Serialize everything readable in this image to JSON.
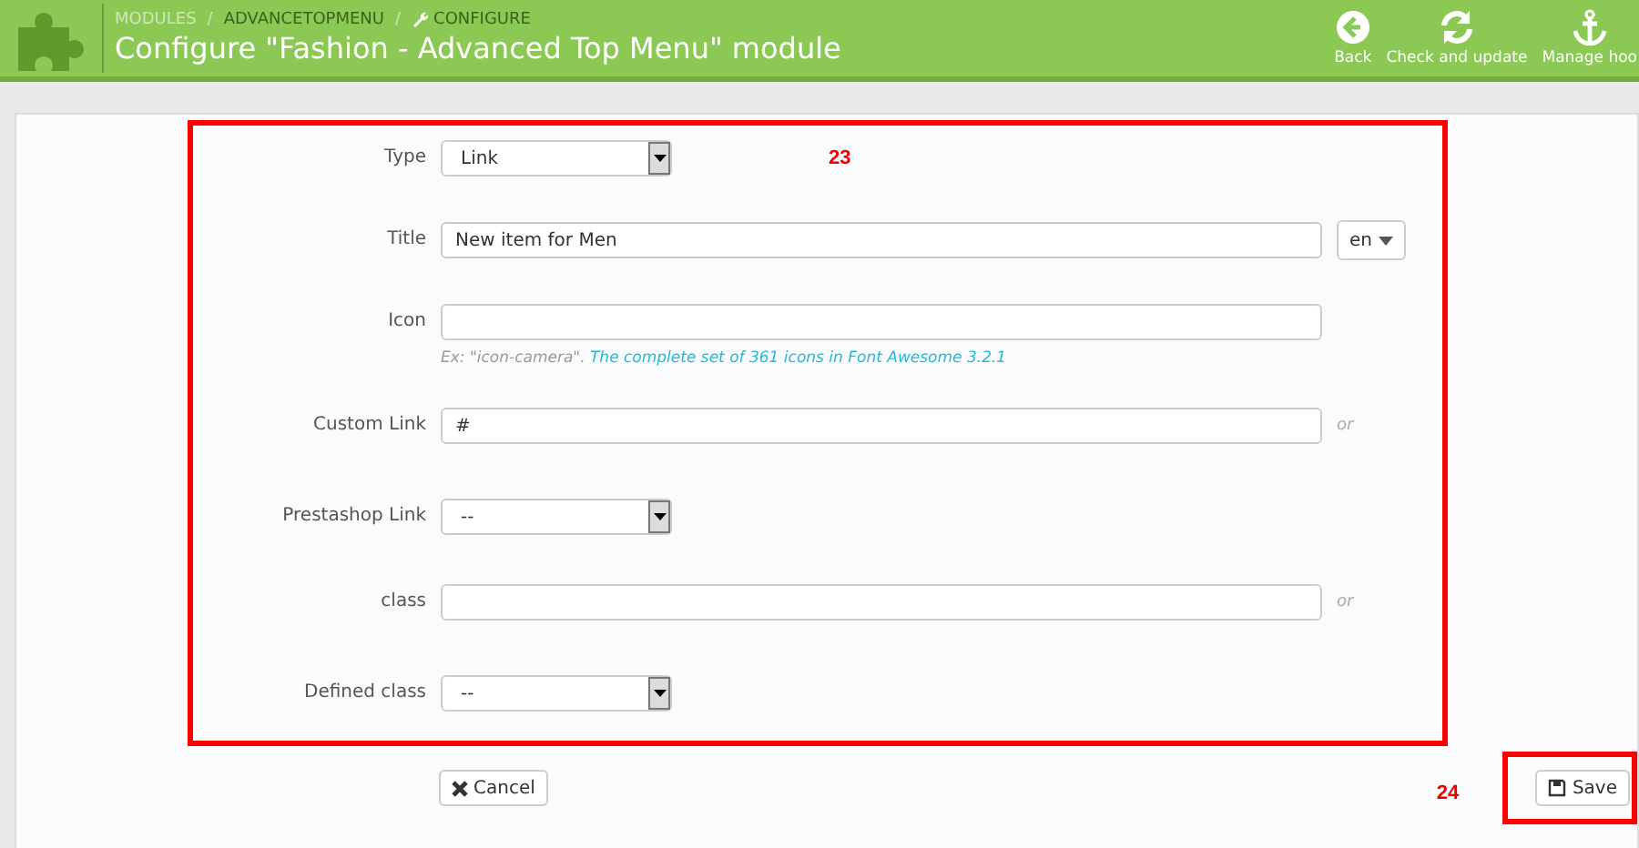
{
  "header": {
    "separator": "/",
    "breadcrumbs": [
      {
        "label": "MODULES",
        "kind": "plain"
      },
      {
        "label": "ADVANCETOPMENU",
        "kind": "plain"
      },
      {
        "label": "CONFIGURE",
        "kind": "wrench"
      }
    ],
    "title": "Configure \"Fashion - Advanced Top Menu\" module",
    "toolbar": [
      {
        "label": "Back",
        "kind": "back"
      },
      {
        "label": "Check and update",
        "kind": "refresh"
      },
      {
        "label": "Manage hoo",
        "kind": "anchor"
      }
    ]
  },
  "form": {
    "annotation": "23",
    "fields": [
      {
        "label": "Type",
        "kind": "select",
        "value": "Link"
      },
      {
        "label": "Title",
        "kind": "lang-text",
        "value": "New item for Men",
        "lang": "en"
      },
      {
        "label": "Icon",
        "kind": "text",
        "help": "Ex: \"icon-camera\". ",
        "help_link": "The complete set of 361 icons in Font Awesome 3.2.1"
      },
      {
        "label": "Custom Link",
        "kind": "text",
        "value": "#",
        "suffix": "or"
      },
      {
        "label": "Prestashop Link",
        "kind": "select",
        "value": "--"
      },
      {
        "label": "class",
        "kind": "text",
        "suffix": "or"
      },
      {
        "label": "Defined class",
        "kind": "select",
        "value": "--"
      }
    ]
  },
  "footer": {
    "cancel": "Cancel",
    "annotation": "24",
    "save": "Save"
  }
}
